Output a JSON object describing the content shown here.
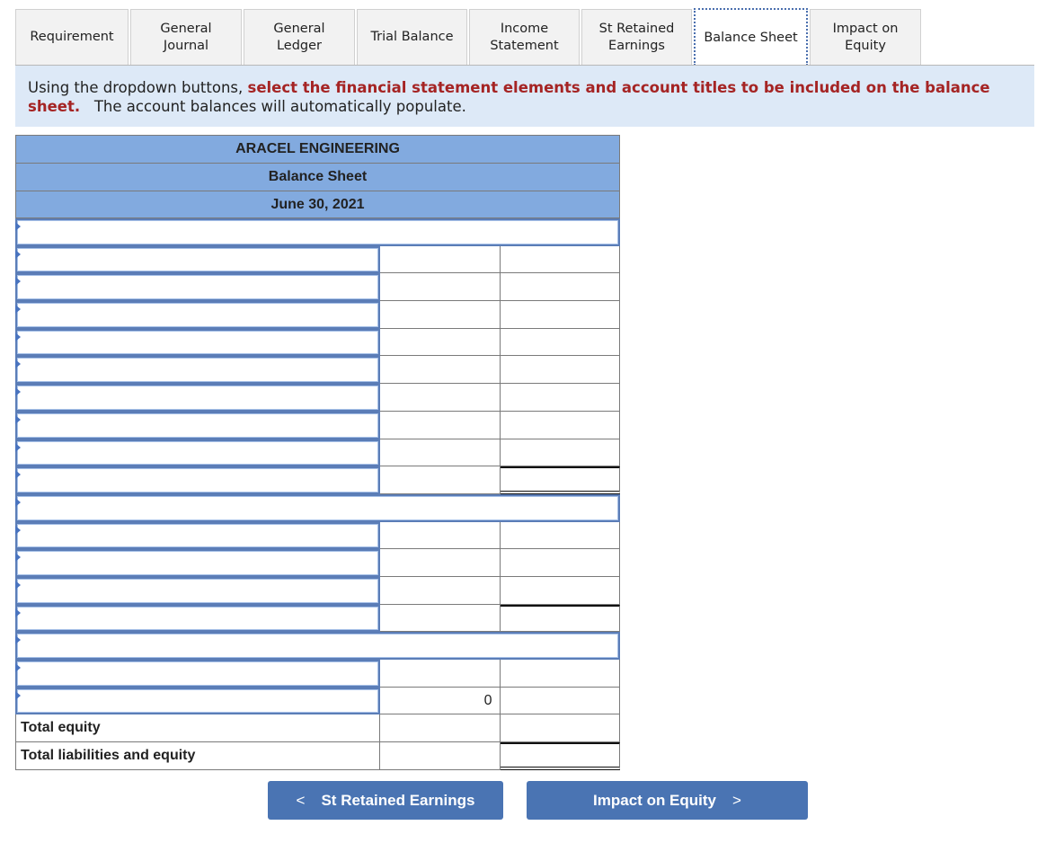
{
  "tabs": [
    {
      "label": "Requirement",
      "active": false
    },
    {
      "label": "General Journal",
      "active": false
    },
    {
      "label": "General Ledger",
      "active": false
    },
    {
      "label": "Trial Balance",
      "active": false
    },
    {
      "label": "Income Statement",
      "active": false
    },
    {
      "label": "St Retained Earnings",
      "active": false
    },
    {
      "label": "Balance Sheet",
      "active": true
    },
    {
      "label": "Impact on Equity",
      "active": false
    }
  ],
  "instructions": {
    "lead": "Using the dropdown buttons, ",
    "emphasis": "select the financial statement elements and account titles to be included on the balance sheet.",
    "tail": "   The account balances will automatically populate."
  },
  "sheet": {
    "company": "ARACEL ENGINEERING",
    "title": "Balance Sheet",
    "date": "June 30, 2021",
    "zero_value": "0",
    "total_equity_label": "Total equity",
    "total_liabilities_equity_label": "Total liabilities and equity"
  },
  "nav": {
    "prev_label": "St Retained Earnings",
    "next_label": "Impact on Equity",
    "prev_icon": "chevron-left-icon",
    "next_icon": "chevron-right-icon"
  }
}
